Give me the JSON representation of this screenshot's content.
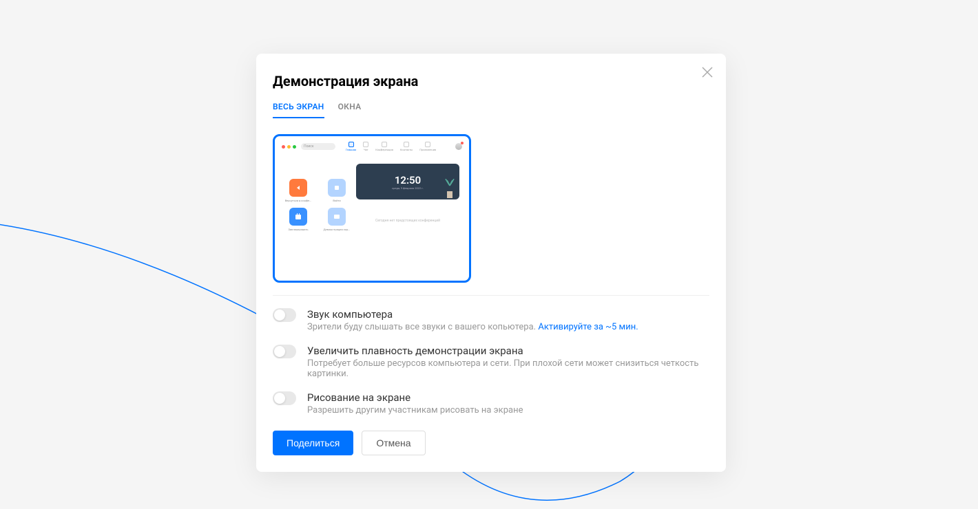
{
  "modal": {
    "title": "Демонстрация экрана",
    "tabs": {
      "fullscreen": "ВЕСЬ ЭКРАН",
      "windows": "ОКНА"
    },
    "preview": {
      "search_placeholder": "Поиск",
      "nav": {
        "home": "Главная",
        "chat": "Чат",
        "conference": "Конференция",
        "contacts": "Контакты",
        "recordings": "Приложения"
      },
      "tiles": {
        "return": "Вернуться в конфе...",
        "login": "Войти",
        "schedule": "Запланировать",
        "demo": "Демонстрация экр..."
      },
      "clock_time": "12:50",
      "clock_date": "среда, 9 февраля 2022 г.",
      "empty_msg": "Сегодня нет предстоящих конференций"
    },
    "options": {
      "sound": {
        "title": "Звук компьютера",
        "desc": "Зрители буду слышать все звуки с вашего копьютера. ",
        "link": "Активируйте за ~5 мин."
      },
      "smooth": {
        "title": "Увеличить плавность демонстрации экрана",
        "desc": "Потребует больше ресурсов компьютера и сети. При плохой сети может снизиться четкость картинки."
      },
      "draw": {
        "title": "Рисование на экране",
        "desc": "Разрешить другим участникам рисовать на экране"
      }
    },
    "actions": {
      "share": "Поделиться",
      "cancel": "Отмена"
    }
  }
}
